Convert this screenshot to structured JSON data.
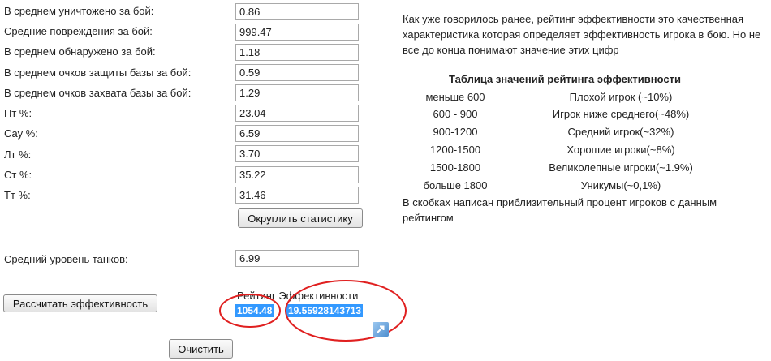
{
  "stats": [
    {
      "label": "В среднем уничтожено за бой:",
      "value": "0.86"
    },
    {
      "label": "Средние повреждения за бой:",
      "value": "999.47"
    },
    {
      "label": "В среднем обнаружено за бой:",
      "value": "1.18"
    },
    {
      "label": "В среднем очков защиты базы за бой:",
      "value": "0.59"
    },
    {
      "label": "В среднем очков захвата базы за бой:",
      "value": "1.29"
    },
    {
      "label": "Пт %:",
      "value": "23.04"
    },
    {
      "label": "Сау %:",
      "value": "6.59"
    },
    {
      "label": "Лт %:",
      "value": "3.70"
    },
    {
      "label": "Ст %:",
      "value": "35.22"
    },
    {
      "label": "Тт %:",
      "value": "31.46"
    }
  ],
  "round_button": "Округлить статистику",
  "avg_tier": {
    "label": "Средний уровень танков:",
    "value": "6.99"
  },
  "calc_button": "Рассчитать эффективность",
  "result": {
    "label": "Рейтинг Эффективности",
    "value1": "1054.48",
    "value2": "19.55928143713"
  },
  "clear_button": "Очистить",
  "info": {
    "intro": "Как уже говорилось ранее, рейтинг эффективности это качественная характеристика которая определяет эффективность игрока в бою. Но не все до конца понимают значение этих цифр",
    "table_title": "Таблица значений рейтинга эффективности",
    "rows": [
      {
        "range": "меньше 600",
        "desc": "Плохой игрок (~10%)"
      },
      {
        "range": "600 - 900",
        "desc": "Игрок ниже среднего(~48%)"
      },
      {
        "range": "900-1200",
        "desc": "Средний игрок(~32%)"
      },
      {
        "range": "1200-1500",
        "desc": "Хорошие игроки(~8%)"
      },
      {
        "range": "1500-1800",
        "desc": "Великолепные игроки(~1.9%)"
      },
      {
        "range": "больше 1800",
        "desc": "Уникумы(~0,1%)"
      }
    ],
    "footnote": "В скобках написан приблизительный процент игроков с данным рейтингом"
  },
  "colors": {
    "highlight": "#3399ff",
    "annotation": "#e02020",
    "link_icon": "#6fa8dc"
  }
}
